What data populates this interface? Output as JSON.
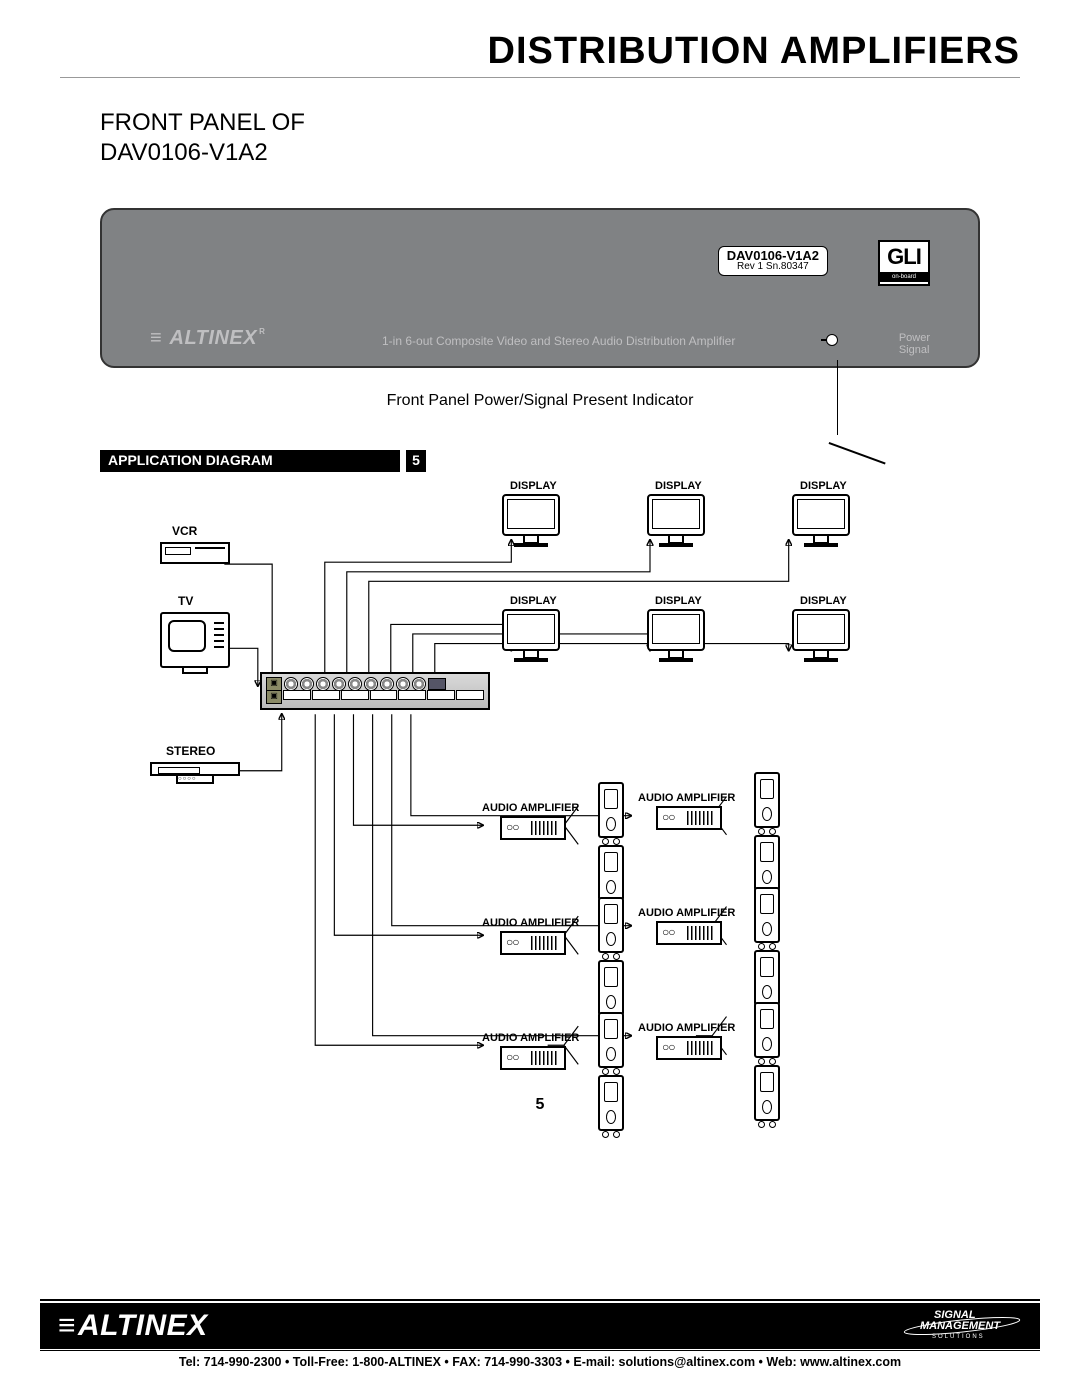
{
  "header": {
    "page_title": "DISTRIBUTION AMPLIFIERS"
  },
  "front_panel": {
    "section_title_line1": "FRONT PANEL OF",
    "section_title_line2": "DAV0106-V1A2",
    "model_label": "DAV0106-V1A2",
    "model_sub": "Rev 1 Sn.80347",
    "gli": "GLI",
    "gli_sub": "on-board",
    "brand": "ALTINEX",
    "brand_r": "R",
    "desc": "1-in 6-out Composite Video and Stereo Audio Distribution Amplifier",
    "power": "Power",
    "signal": "Signal",
    "callout": "Front Panel Power/Signal Present Indicator"
  },
  "app_diagram": {
    "bar_label": "APPLICATION DIAGRAM",
    "bar_num": "5",
    "vcr": "VCR",
    "tv": "TV",
    "stereo": "STEREO",
    "display": "DISPLAY",
    "audio_amp": "AUDIO AMPLIFIER"
  },
  "page_number": "5",
  "footer": {
    "brand": "ALTINEX",
    "signal_mgmt_l1": "SIGNAL",
    "signal_mgmt_l2": "MANAGEMENT",
    "signal_mgmt_l3": "S O L U T I O N S",
    "contact": "Tel: 714-990-2300 • Toll-Free: 1-800-ALTINEX • FAX: 714-990-3303 • E-mail: solutions@altinex.com • Web: www.altinex.com"
  }
}
